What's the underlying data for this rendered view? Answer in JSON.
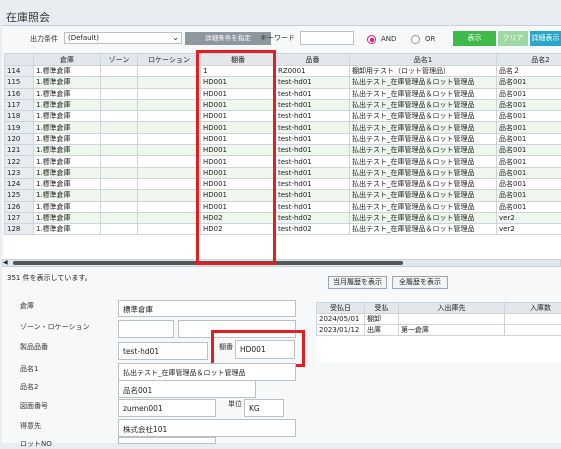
{
  "window_title": "在庫照会",
  "toolbar": {
    "output_condition_label": "出力条件",
    "output_condition_value": "(Default)",
    "detail_cond_button": "詳細条件を指定",
    "keyword_label": "キーワード",
    "keyword_value": "",
    "and_label": "AND",
    "or_label": "OR",
    "display_button": "表示",
    "clear_button": "クリア",
    "detail_display_button": "詳細表示"
  },
  "grid": {
    "columns": [
      "",
      "倉庫",
      "ゾーン",
      "ロケーション",
      "棚番",
      "品番",
      "品名1",
      "品名2"
    ],
    "rows": [
      [
        "114",
        "1.標準倉庫",
        "",
        "",
        "1",
        "RZ0001",
        "棚卸用テスト（ロット管理品）",
        "品名２"
      ],
      [
        "115",
        "1.標準倉庫",
        "",
        "",
        "HD001",
        "test-hd01",
        "払出テスト_在庫管理品＆ロット管理品",
        "品名001"
      ],
      [
        "116",
        "1.標準倉庫",
        "",
        "",
        "HD001",
        "test-hd01",
        "払出テスト_在庫管理品＆ロット管理品",
        "品名001"
      ],
      [
        "117",
        "1.標準倉庫",
        "",
        "",
        "HD001",
        "test-hd01",
        "払出テスト_在庫管理品＆ロット管理品",
        "品名001"
      ],
      [
        "118",
        "1.標準倉庫",
        "",
        "",
        "HD001",
        "test-hd01",
        "払出テスト_在庫管理品＆ロット管理品",
        "品名001"
      ],
      [
        "119",
        "1.標準倉庫",
        "",
        "",
        "HD001",
        "test-hd01",
        "払出テスト_在庫管理品＆ロット管理品",
        "品名001"
      ],
      [
        "120",
        "1.標準倉庫",
        "",
        "",
        "HD001",
        "test-hd01",
        "払出テスト_在庫管理品＆ロット管理品",
        "品名001"
      ],
      [
        "121",
        "1.標準倉庫",
        "",
        "",
        "HD001",
        "test-hd01",
        "払出テスト_在庫管理品＆ロット管理品",
        "品名001"
      ],
      [
        "122",
        "1.標準倉庫",
        "",
        "",
        "HD001",
        "test-hd01",
        "払出テスト_在庫管理品＆ロット管理品",
        "品名001"
      ],
      [
        "123",
        "1.標準倉庫",
        "",
        "",
        "HD001",
        "test-hd01",
        "払出テスト_在庫管理品＆ロット管理品",
        "品名001"
      ],
      [
        "124",
        "1.標準倉庫",
        "",
        "",
        "HD001",
        "test-hd01",
        "払出テスト_在庫管理品＆ロット管理品",
        "品名001"
      ],
      [
        "125",
        "1.標準倉庫",
        "",
        "",
        "HD001",
        "test-hd01",
        "払出テスト_在庫管理品＆ロット管理品",
        "品名001"
      ],
      [
        "126",
        "1.標準倉庫",
        "",
        "",
        "HD001",
        "test-hd01",
        "払出テスト_在庫管理品＆ロット管理品",
        "品名001"
      ],
      [
        "127",
        "1.標準倉庫",
        "",
        "",
        "HD02",
        "test-hd02",
        "払出テスト_在庫管理品＆ロット管理品",
        "ver2"
      ],
      [
        "128",
        "1.標準倉庫",
        "",
        "",
        "HD02",
        "test-hd02",
        "払出テスト_在庫管理品＆ロット管理品",
        "ver2"
      ]
    ]
  },
  "status_text": "351 件を表示しています。",
  "history_buttons": {
    "current_month": "当月履歴を表示",
    "all": "全履歴を表示"
  },
  "detail": {
    "warehouse_label": "倉庫",
    "warehouse_value": "標準倉庫",
    "zone_loc_label": "ゾーン・ロケーション",
    "zone_value": "",
    "loc_value": "",
    "product_code_label": "製品品番",
    "product_code_value": "test-hd01",
    "shelf_label": "棚番",
    "shelf_value": "HD001",
    "name1_label": "品名1",
    "name1_value": "払出テスト_在庫管理品＆ロット管理品",
    "name2_label": "品名2",
    "name2_value": "品名001",
    "drawing_label": "図面番号",
    "drawing_value": "zumen001",
    "unit_label": "単位",
    "unit_value": "KG",
    "customer_label": "得意先",
    "customer_value": "株式会社101",
    "lot_label": "ロットNO",
    "lot_value": ""
  },
  "history": {
    "columns": [
      "受払日",
      "受払",
      "入出庫先",
      "入庫数"
    ],
    "rows": [
      [
        "2024/05/01",
        "棚卸",
        "",
        ""
      ],
      [
        "2023/01/12",
        "出庫",
        "第一倉庫",
        ""
      ]
    ]
  },
  "colors": {
    "accent_green": "#3fb94a",
    "accent_teal": "#2aa6c9",
    "highlight_red": "#e02020",
    "radio_pink": "#e0157a"
  }
}
